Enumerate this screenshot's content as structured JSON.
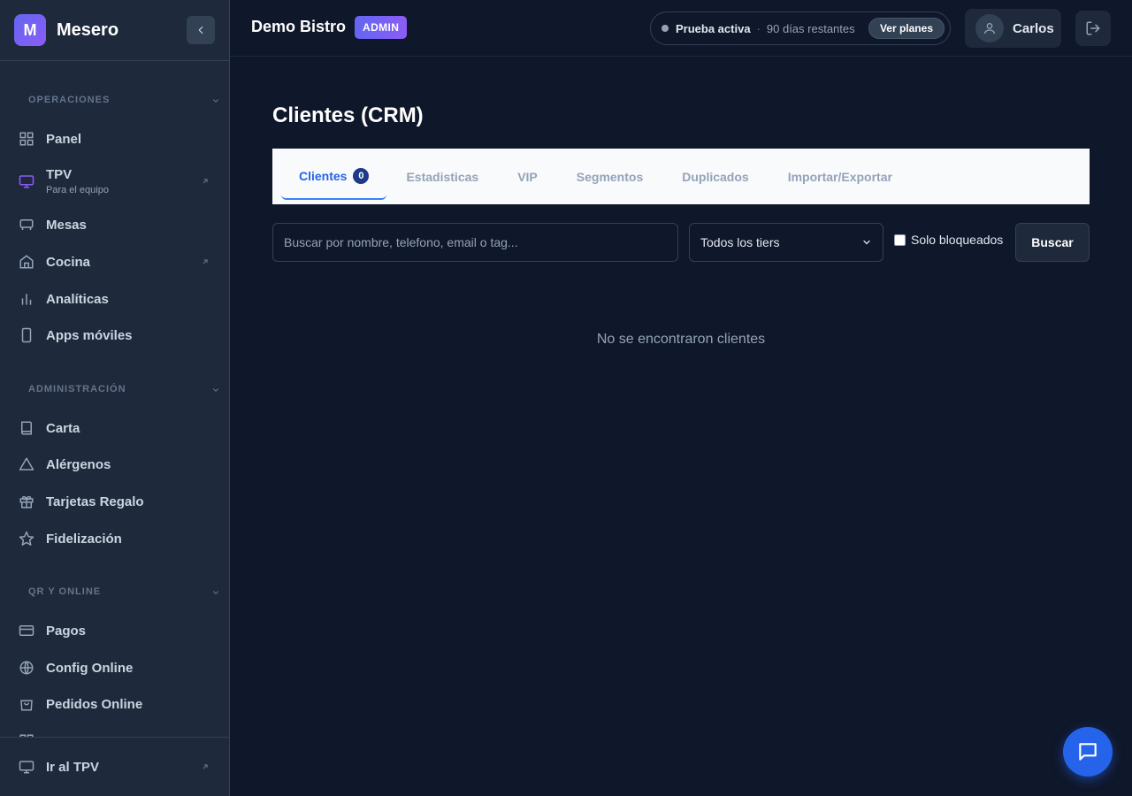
{
  "sidebar": {
    "logo_letter": "M",
    "brand": "Mesero",
    "sections": [
      {
        "title": "OPERACIONES"
      },
      {
        "title": "ADMINISTRACIÓN"
      },
      {
        "title": "QR Y ONLINE"
      }
    ],
    "items": [
      {
        "label": "Panel",
        "icon": "grid-icon"
      },
      {
        "label": "TPV",
        "sub": "Para el equipo",
        "icon": "monitor-icon",
        "external": true
      },
      {
        "label": "Mesas",
        "icon": "table-icon"
      },
      {
        "label": "Cocina",
        "icon": "home-icon",
        "external": true
      },
      {
        "label": "Analíticas",
        "icon": "bar-chart-icon"
      },
      {
        "label": "Apps móviles",
        "icon": "smartphone-icon"
      },
      {
        "label": "Carta",
        "icon": "book-icon"
      },
      {
        "label": "Alérgenos",
        "icon": "warning-icon"
      },
      {
        "label": "Tarjetas Regalo",
        "icon": "gift-icon"
      },
      {
        "label": "Fidelización",
        "icon": "star-icon"
      },
      {
        "label": "Pagos",
        "icon": "credit-card-icon"
      },
      {
        "label": "Config Online",
        "icon": "globe-icon"
      },
      {
        "label": "Pedidos Online",
        "icon": "shopping-bag-icon"
      }
    ],
    "footer": {
      "label": "Ir al TPV",
      "icon": "monitor-icon"
    }
  },
  "header": {
    "business": "Demo Bistro",
    "role_badge": "ADMIN",
    "trial_status": "Prueba activa",
    "trial_separator": "·",
    "trial_remaining": "90 días restantes",
    "plans_button": "Ver planes",
    "user_name": "Carlos"
  },
  "main": {
    "title": "Clientes (CRM)",
    "tabs": [
      {
        "label": "Clientes",
        "count": "0",
        "active": true
      },
      {
        "label": "Estadisticas"
      },
      {
        "label": "VIP"
      },
      {
        "label": "Segmentos"
      },
      {
        "label": "Duplicados"
      },
      {
        "label": "Importar/Exportar"
      }
    ],
    "search_placeholder": "Buscar por nombre, telefono, email o tag...",
    "tier_select": "Todos los tiers",
    "blocked_only_label": "Solo bloqueados",
    "search_button": "Buscar",
    "empty_message": "No se encontraron clientes"
  },
  "colors": {
    "background": "#0f172a",
    "sidebar": "#1e293b",
    "accent": "#2563eb",
    "badge": "#6366f1"
  }
}
